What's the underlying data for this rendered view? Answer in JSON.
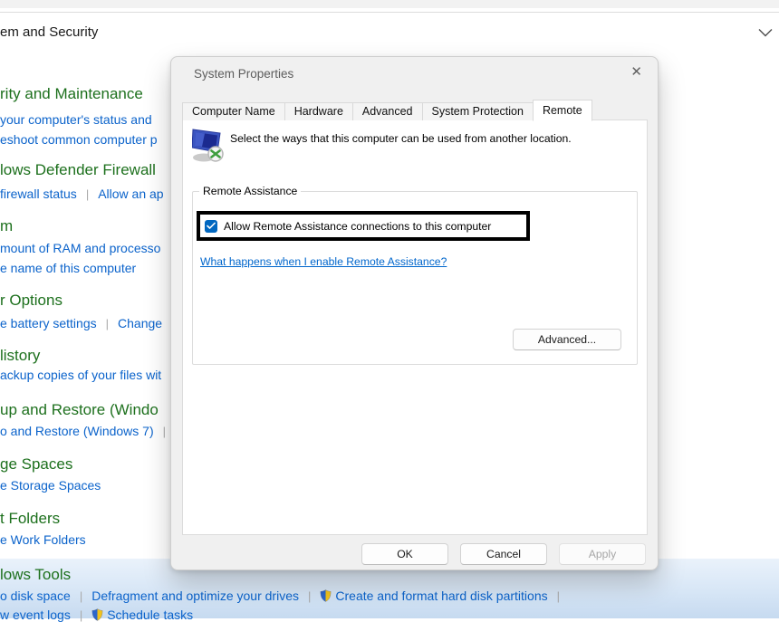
{
  "colors": {
    "heading_green": "#1d701d",
    "link_blue": "#0b63cb",
    "checkbox_blue": "#0067c0",
    "dialog_bg": "#f0f0f0"
  },
  "topbar": {
    "breadcrumb": "em and Security"
  },
  "background": {
    "sections": [
      {
        "heading": "rity and Maintenance",
        "rows": [
          [
            "your computer's status and"
          ],
          [
            "eshoot common computer p"
          ]
        ]
      },
      {
        "heading": "lows Defender Firewall",
        "rows": [
          [
            "firewall status",
            "Allow an ap"
          ]
        ]
      },
      {
        "heading": "m",
        "rows": [
          [
            "mount of RAM and processo"
          ],
          [
            "e name of this computer"
          ]
        ]
      },
      {
        "heading": "r Options",
        "rows": [
          [
            "e battery settings",
            "Change"
          ]
        ]
      },
      {
        "heading": "listory",
        "rows": [
          [
            "ackup copies of your files wit"
          ]
        ]
      },
      {
        "heading": "up and Restore (Windo",
        "rows": [
          [
            "o and Restore (Windows 7)"
          ]
        ]
      },
      {
        "heading": "ge Spaces",
        "rows": [
          [
            "e Storage Spaces"
          ]
        ]
      },
      {
        "heading": "t Folders",
        "rows": [
          [
            "e Work Folders"
          ]
        ]
      }
    ],
    "tools_band": {
      "heading": "lows Tools",
      "row1": [
        "o disk space",
        "Defragment and optimize your drives",
        "Create and format hard disk partitions"
      ],
      "row2": [
        "w event logs",
        "Schedule tasks"
      ]
    }
  },
  "dialog": {
    "title": "System Properties",
    "close_glyph": "✕",
    "tabs": [
      "Computer Name",
      "Hardware",
      "Advanced",
      "System Protection",
      "Remote"
    ],
    "active_tab": "Remote",
    "intro": "Select the ways that this computer can be used from another location.",
    "remote_assistance": {
      "group_label": "Remote Assistance",
      "checkbox_label": "Allow Remote Assistance connections to this computer",
      "checkbox_checked": true,
      "help_link": "What happens when I enable Remote Assistance?",
      "advanced_button": "Advanced..."
    },
    "footer": {
      "ok": "OK",
      "cancel": "Cancel",
      "apply": "Apply",
      "apply_disabled": true
    }
  }
}
